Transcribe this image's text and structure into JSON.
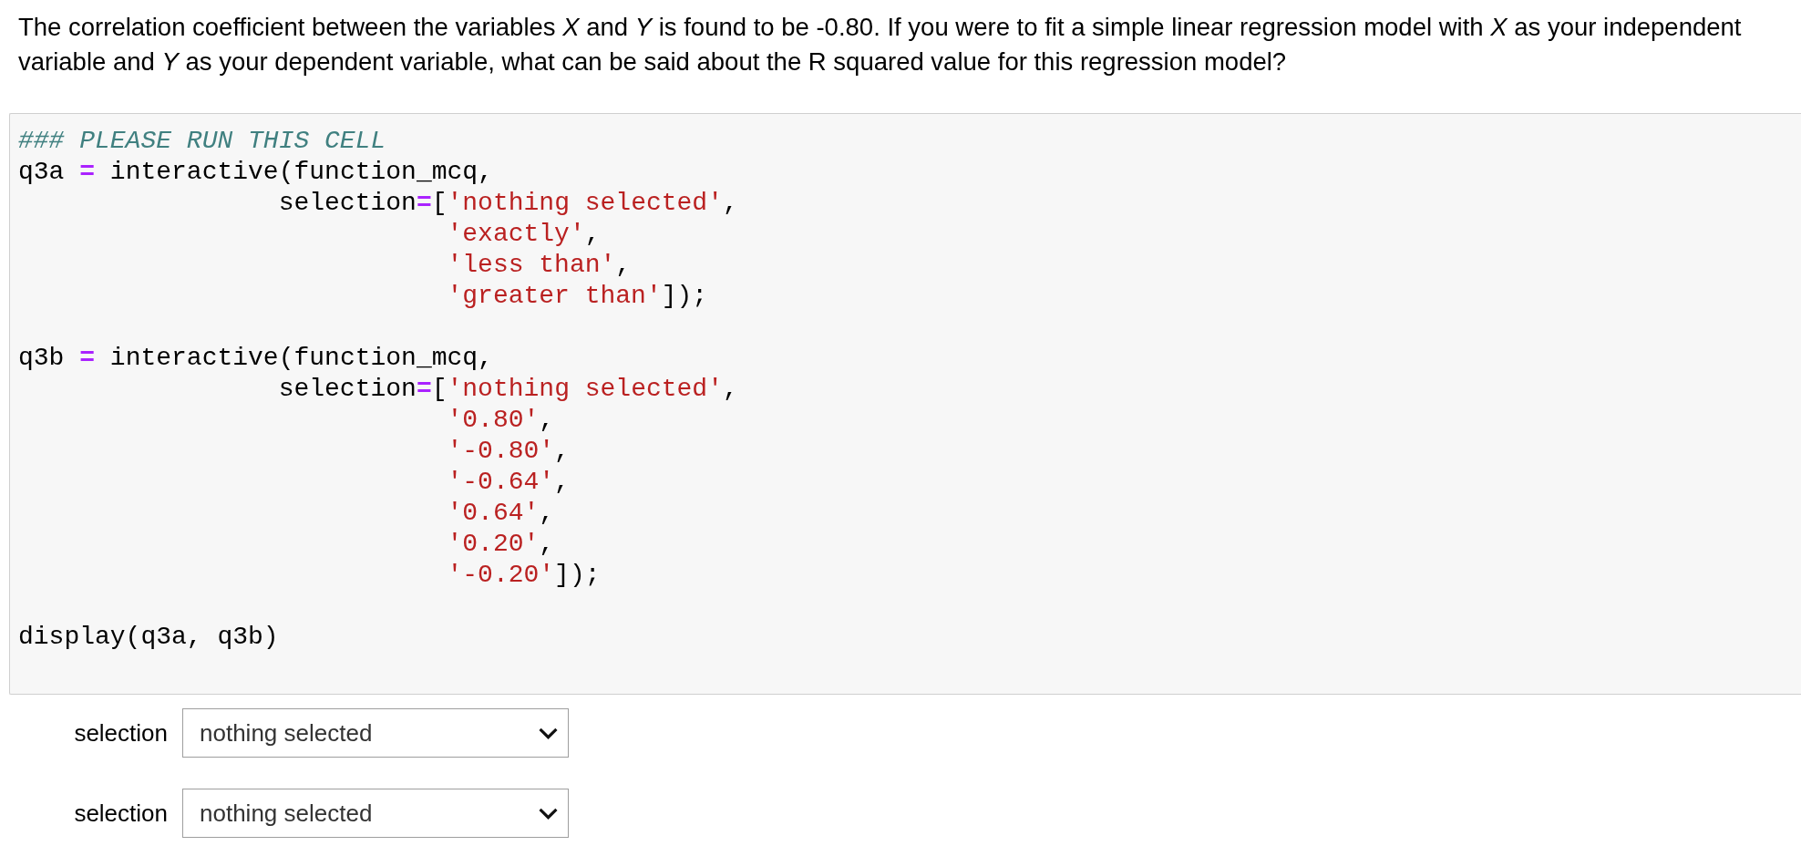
{
  "question": "The correlation coefficient between the variables *X* and *Y* is found to be -0.80. If you were to fit a simple linear regression model with *X* as your independent variable and *Y* as your dependent variable, what can be said about the R squared value for this regression model?",
  "code_cell": {
    "blocks": [
      {
        "lines": [
          {
            "tokens": [
              {
                "kind": "comment",
                "text": "### PLEASE RUN THIS CELL"
              }
            ]
          },
          {
            "tokens": [
              {
                "kind": "plain",
                "text": "q3a "
              },
              {
                "kind": "operator",
                "text": "="
              },
              {
                "kind": "plain",
                "text": " interactive(function_mcq,"
              }
            ]
          },
          {
            "tokens": [
              {
                "kind": "plain",
                "text": "                 selection"
              },
              {
                "kind": "operator",
                "text": "="
              },
              {
                "kind": "plain",
                "text": "["
              },
              {
                "kind": "string",
                "text": "'nothing selected'"
              },
              {
                "kind": "plain",
                "text": ","
              }
            ]
          },
          {
            "tokens": [
              {
                "kind": "string",
                "text": "                            'exactly'"
              },
              {
                "kind": "plain",
                "text": ","
              }
            ]
          },
          {
            "tokens": [
              {
                "kind": "string",
                "text": "                            'less than'"
              },
              {
                "kind": "plain",
                "text": ","
              }
            ]
          },
          {
            "tokens": [
              {
                "kind": "string",
                "text": "                            'greater than'"
              },
              {
                "kind": "plain",
                "text": "]);"
              }
            ]
          }
        ]
      },
      {
        "lines": [
          {
            "tokens": [
              {
                "kind": "plain",
                "text": "q3b "
              },
              {
                "kind": "operator",
                "text": "="
              },
              {
                "kind": "plain",
                "text": " interactive(function_mcq,"
              }
            ]
          },
          {
            "tokens": [
              {
                "kind": "plain",
                "text": "                 selection"
              },
              {
                "kind": "operator",
                "text": "="
              },
              {
                "kind": "plain",
                "text": "["
              },
              {
                "kind": "string",
                "text": "'nothing selected'"
              },
              {
                "kind": "plain",
                "text": ","
              }
            ]
          },
          {
            "tokens": [
              {
                "kind": "string",
                "text": "                            '0.80'"
              },
              {
                "kind": "plain",
                "text": ","
              }
            ]
          },
          {
            "tokens": [
              {
                "kind": "string",
                "text": "                            '-0.80'"
              },
              {
                "kind": "plain",
                "text": ","
              }
            ]
          },
          {
            "tokens": [
              {
                "kind": "string",
                "text": "                            '-0.64'"
              },
              {
                "kind": "plain",
                "text": ","
              }
            ]
          },
          {
            "tokens": [
              {
                "kind": "string",
                "text": "                            '0.64'"
              },
              {
                "kind": "plain",
                "text": ","
              }
            ]
          },
          {
            "tokens": [
              {
                "kind": "string",
                "text": "                            '0.20'"
              },
              {
                "kind": "plain",
                "text": ","
              }
            ]
          },
          {
            "tokens": [
              {
                "kind": "string",
                "text": "                            '-0.20'"
              },
              {
                "kind": "plain",
                "text": "]);"
              }
            ]
          }
        ]
      },
      {
        "lines": [
          {
            "tokens": [
              {
                "kind": "plain",
                "text": "display(q3a, q3b)"
              }
            ]
          }
        ]
      }
    ]
  },
  "widgets": [
    {
      "label": "selection",
      "value": "nothing selected"
    },
    {
      "label": "selection",
      "value": "nothing selected"
    }
  ]
}
